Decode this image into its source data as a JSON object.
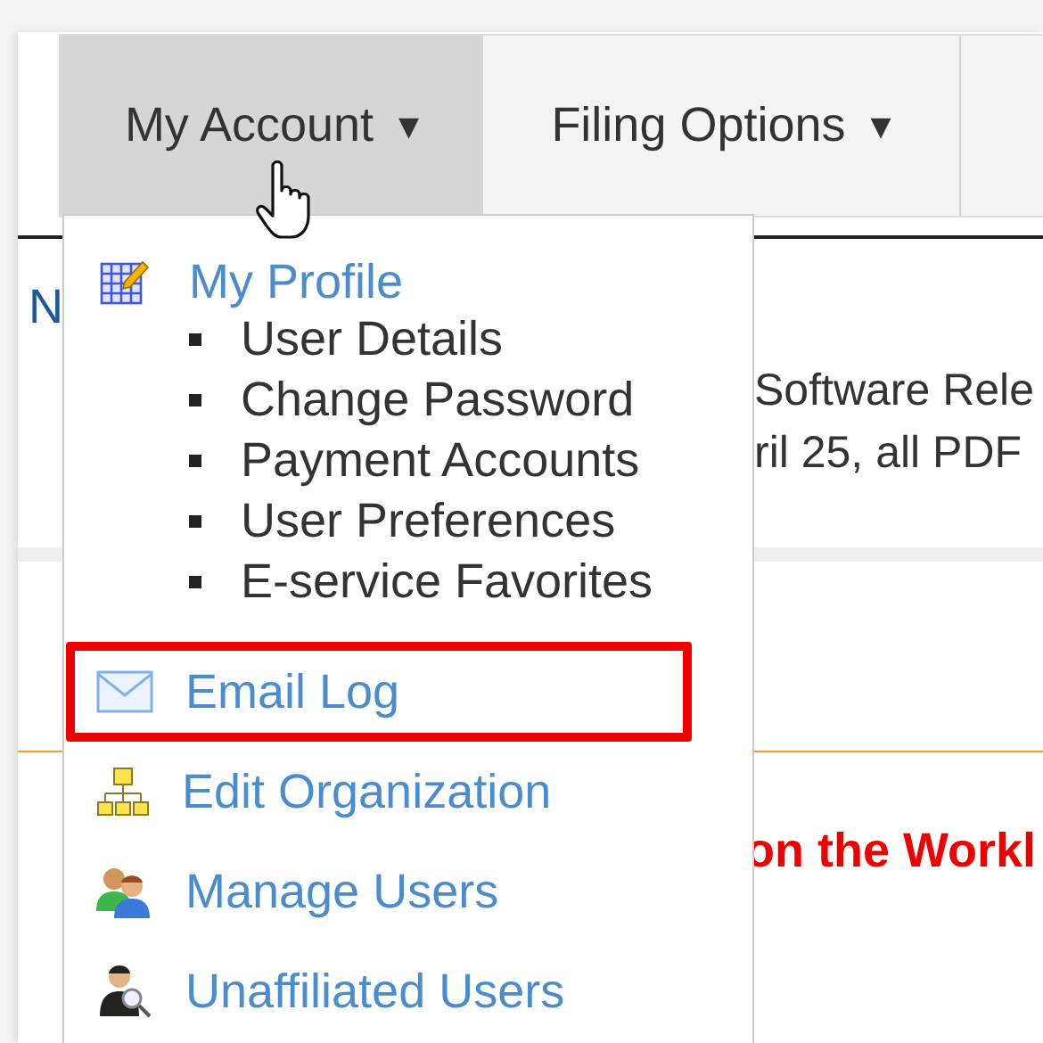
{
  "nav": {
    "tabs": [
      {
        "label": "My Account",
        "caret": "▼",
        "selected": true
      },
      {
        "label": "Filing Options",
        "caret": "▼",
        "selected": false
      }
    ]
  },
  "background": {
    "heading_fragment": "N",
    "lines": [
      "Software Rele",
      "ril 25, all PDF"
    ],
    "alert_fragment": "on the Workl"
  },
  "account_menu": {
    "items": [
      {
        "label": "My Profile",
        "highlighted": false,
        "children": [
          {
            "label": "User Details"
          },
          {
            "label": "Change Password"
          },
          {
            "label": "Payment Accounts"
          },
          {
            "label": "User Preferences"
          },
          {
            "label": "E-service Favorites"
          }
        ]
      },
      {
        "label": "Email Log",
        "highlighted": true
      },
      {
        "label": "Edit Organization",
        "highlighted": false
      },
      {
        "label": "Manage Users",
        "highlighted": false
      },
      {
        "label": "Unaffiliated Users",
        "highlighted": false
      }
    ]
  }
}
